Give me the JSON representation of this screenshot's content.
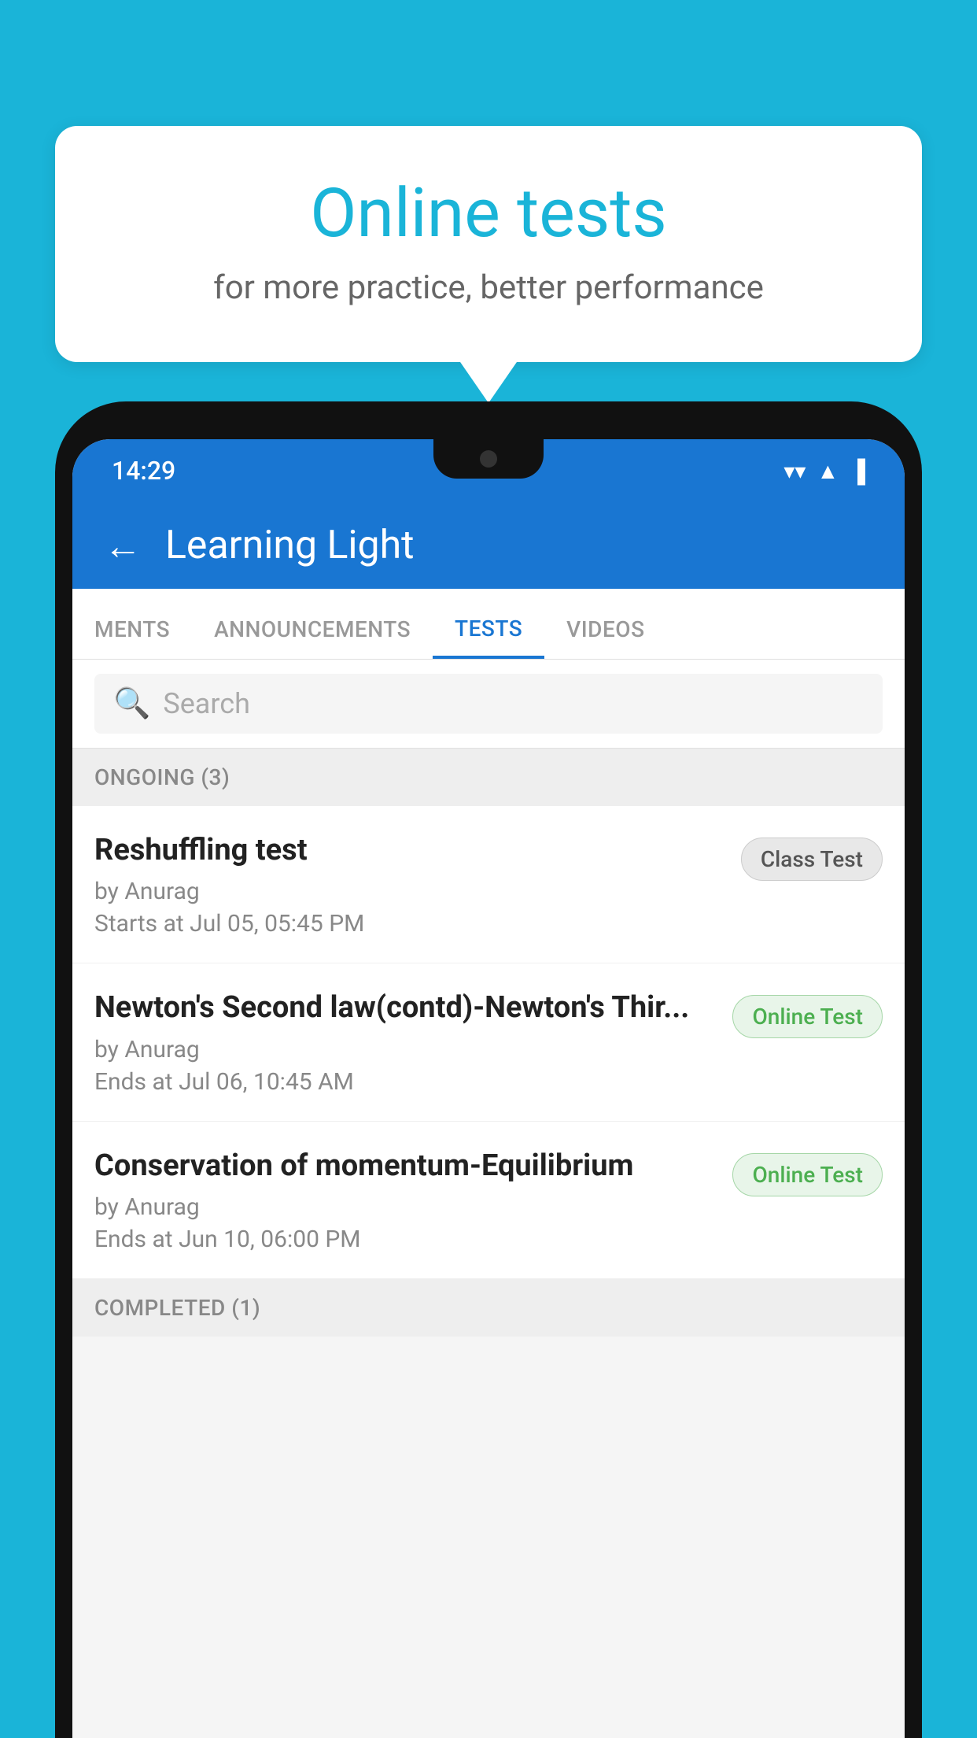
{
  "background_color": "#1ab4d8",
  "speech_bubble": {
    "title": "Online tests",
    "subtitle": "for more practice, better performance"
  },
  "status_bar": {
    "time": "14:29",
    "wifi": "▼",
    "signal": "▲",
    "battery": "▐"
  },
  "app_header": {
    "title": "Learning Light",
    "back_label": "←"
  },
  "tabs": [
    {
      "label": "MENTS",
      "active": false
    },
    {
      "label": "ANNOUNCEMENTS",
      "active": false
    },
    {
      "label": "TESTS",
      "active": true
    },
    {
      "label": "VIDEOS",
      "active": false
    }
  ],
  "search": {
    "placeholder": "Search"
  },
  "ongoing_section": {
    "label": "ONGOING (3)"
  },
  "tests": [
    {
      "name": "Reshuffling test",
      "by": "by Anurag",
      "time_label": "Starts at",
      "time": "Jul 05, 05:45 PM",
      "badge": "Class Test",
      "badge_type": "class"
    },
    {
      "name": "Newton's Second law(contd)-Newton's Thir...",
      "by": "by Anurag",
      "time_label": "Ends at",
      "time": "Jul 06, 10:45 AM",
      "badge": "Online Test",
      "badge_type": "online"
    },
    {
      "name": "Conservation of momentum-Equilibrium",
      "by": "by Anurag",
      "time_label": "Ends at",
      "time": "Jun 10, 06:00 PM",
      "badge": "Online Test",
      "badge_type": "online"
    }
  ],
  "completed_section": {
    "label": "COMPLETED (1)"
  }
}
